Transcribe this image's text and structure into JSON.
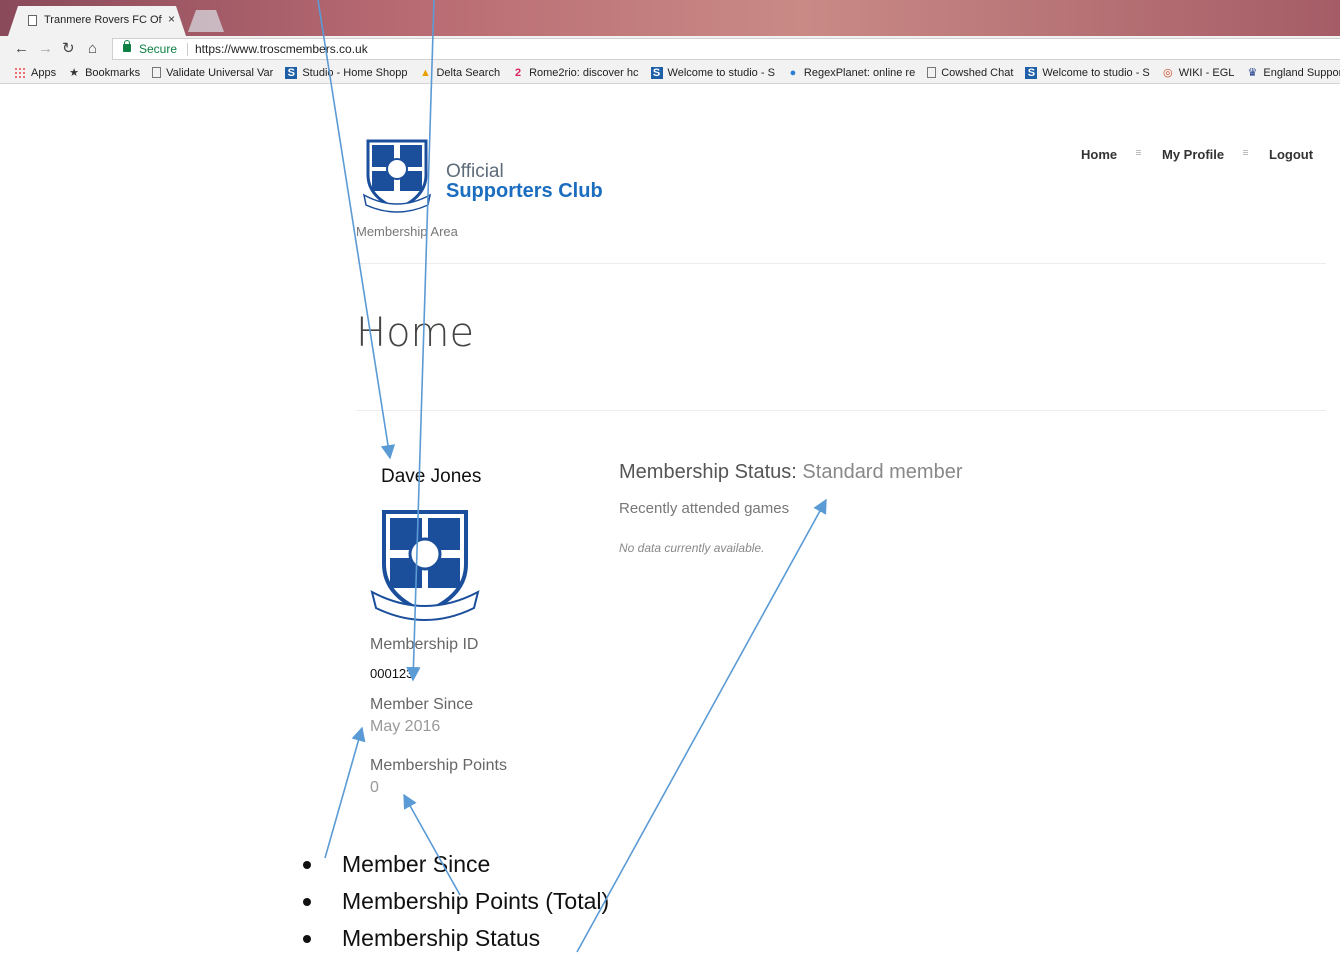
{
  "browser": {
    "tab_title": "Tranmere Rovers FC Offic",
    "tab_close": "×",
    "secure_label": "Secure",
    "url": "https://www.troscmembers.co.uk",
    "bookmarks": [
      {
        "label": "Apps",
        "icon": "apps-grid-icon"
      },
      {
        "label": "Bookmarks",
        "icon": "star-icon"
      },
      {
        "label": "Validate Universal Var",
        "icon": "page-icon"
      },
      {
        "label": "Studio - Home Shopp",
        "icon": "studio-s-icon"
      },
      {
        "label": "Delta Search",
        "icon": "delta-icon"
      },
      {
        "label": "Rome2rio: discover hc",
        "icon": "rome2rio-icon"
      },
      {
        "label": "Welcome to studio - S",
        "icon": "studio-s-icon"
      },
      {
        "label": "RegexPlanet: online re",
        "icon": "globe-icon"
      },
      {
        "label": "Cowshed Chat",
        "icon": "page-icon"
      },
      {
        "label": "Welcome to studio - S",
        "icon": "studio-s-icon"
      },
      {
        "label": "WIKI - EGL",
        "icon": "wiki-icon"
      },
      {
        "label": "England Supporte",
        "icon": "england-crest-icon"
      }
    ]
  },
  "site": {
    "brand_line1": "Official",
    "brand_line2": "Supporters Club",
    "tagline": "Membership Area",
    "nav": [
      {
        "label": "Home"
      },
      {
        "label": "My Profile"
      },
      {
        "label": "Logout"
      }
    ]
  },
  "page": {
    "title": "Home"
  },
  "member": {
    "name": "Dave Jones",
    "id_label": "Membership ID",
    "id_value": "000123",
    "since_label": "Member Since",
    "since_value": "May 2016",
    "points_label": "Membership Points",
    "points_value": "0"
  },
  "status": {
    "label": "Membership Status:",
    "value": "Standard member",
    "recent_heading": "Recently attended games",
    "no_data": "No data currently available."
  },
  "annotations": {
    "bullets": [
      "Member Since",
      "Membership Points (Total)",
      "Membership Status"
    ],
    "arrow_color": "#5b9bd5"
  },
  "colors": {
    "brand_blue": "#1b6dbf",
    "secure_green": "#0b8043"
  }
}
